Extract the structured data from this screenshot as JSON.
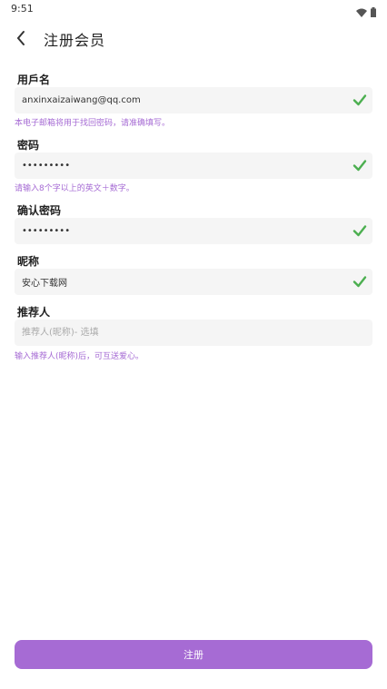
{
  "status_bar": {
    "time": "9:51"
  },
  "header": {
    "title": "注册会员"
  },
  "form": {
    "username": {
      "label": "用戶名",
      "value": "anxinxaizaiwang@qq.com",
      "hint": "本电子邮箱将用于找回密码，请准确填写。"
    },
    "password": {
      "label": "密码",
      "value": "•••••••••",
      "hint": "请输入8个字以上的英文＋数字。"
    },
    "confirm_password": {
      "label": "确认密码",
      "value": "•••••••••"
    },
    "nickname": {
      "label": "昵称",
      "value": "安心下载网"
    },
    "referrer": {
      "label": "推荐人",
      "placeholder": "推荐人(昵称)- 选填",
      "hint": "输入推荐人(昵称)后，可互送爱心。"
    }
  },
  "submit": {
    "label": "注册"
  },
  "colors": {
    "accent": "#a66bd4",
    "check": "#4caf50"
  }
}
